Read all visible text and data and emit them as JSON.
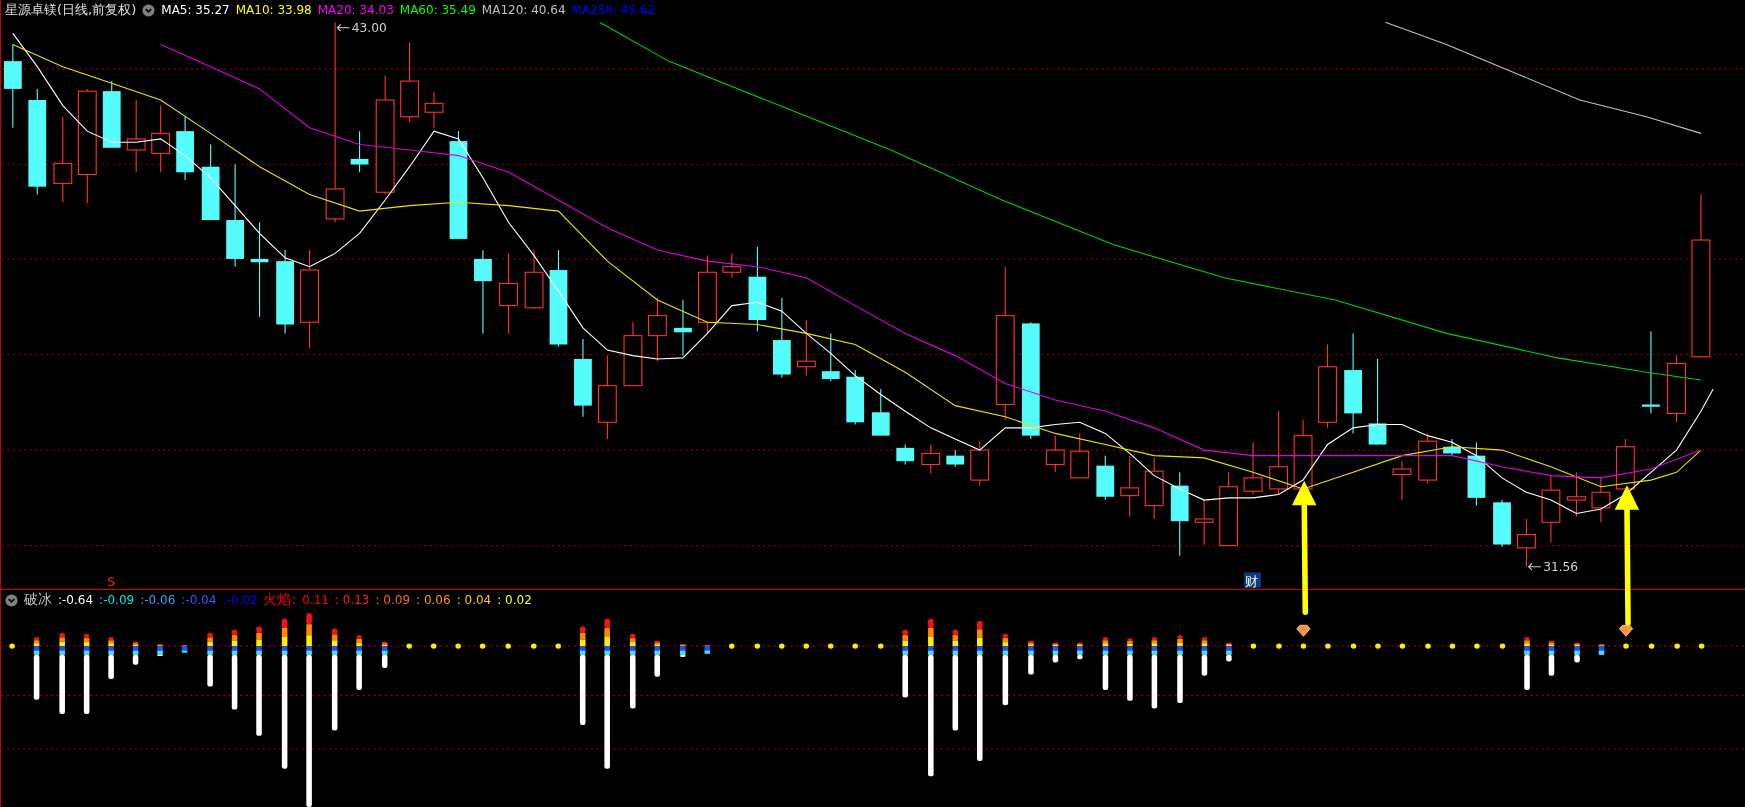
{
  "chart_header": {
    "title": "星源卓镁(日线,前复权)",
    "ma_legend": [
      {
        "text": "MA5: 35.27",
        "color": "#ffffff"
      },
      {
        "text": "MA10: 33.98",
        "color": "#ffff00"
      },
      {
        "text": "MA20: 34.03",
        "color": "#ff00ff"
      },
      {
        "text": "MA60: 35.49",
        "color": "#00ff00"
      },
      {
        "text": "MA120: 40.64",
        "color": "#c0c0c0"
      },
      {
        "text": "MA250: 45.62",
        "color": "#0000ff"
      }
    ]
  },
  "price_marks": [
    {
      "text": "43.00"
    },
    {
      "text": "31.56"
    }
  ],
  "event_marks": [
    {
      "kind": "signal",
      "text": "S"
    },
    {
      "kind": "finance",
      "text": "财"
    }
  ],
  "indicator_legend": [
    {
      "kind": "name",
      "text": "破冰",
      "color": "#c8c8c8"
    },
    {
      "kind": "value",
      "text": ":-0.64",
      "color": "#ffffff"
    },
    {
      "kind": "value",
      "text": ":-0.09",
      "color": "#00e5e5"
    },
    {
      "kind": "value",
      "text": ":-0.06",
      "color": "#3d9bff"
    },
    {
      "kind": "value",
      "text": ":-0.04",
      "color": "#2a5cff"
    },
    {
      "kind": "value",
      "text": ":-0.02",
      "color": "#0000ff"
    },
    {
      "kind": "name",
      "text": "火焰:",
      "color": "#ff0000"
    },
    {
      "kind": "value",
      "text": "0.11",
      "color": "#ff0000"
    },
    {
      "kind": "value",
      "text": ": 0.13",
      "color": "#ff2020"
    },
    {
      "kind": "value",
      "text": ": 0.09",
      "color": "#ff6600"
    },
    {
      "kind": "value",
      "text": ": 0.06",
      "color": "#ff9900"
    },
    {
      "kind": "value",
      "text": ": 0.04",
      "color": "#ffcc00"
    },
    {
      "kind": "value",
      "text": ": 0.02",
      "color": "#ffff00"
    }
  ]
}
